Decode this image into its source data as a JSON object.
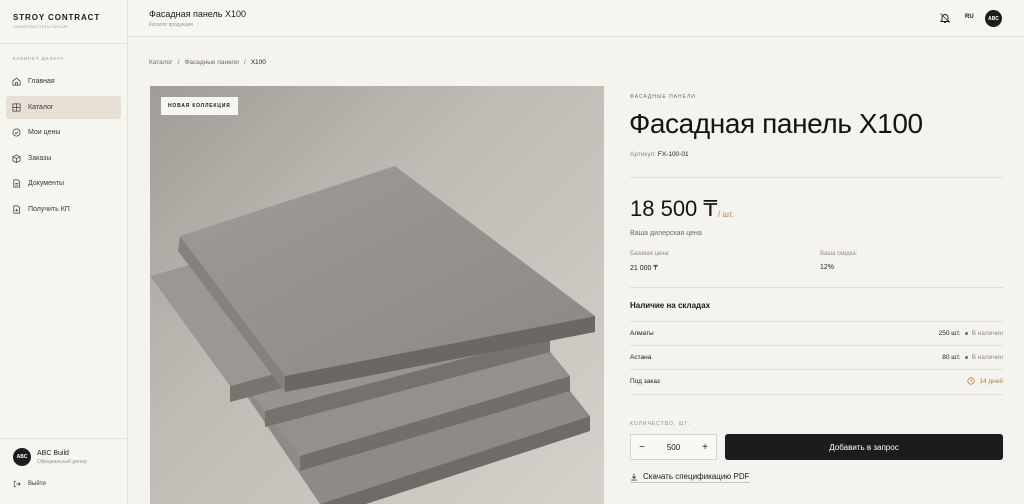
{
  "brand": {
    "name": "STROY CONTRACT",
    "subtitle": "CONSTRUCTION GROUP"
  },
  "sidebar": {
    "section_label": "КАБИНЕТ ДИЛЕРА",
    "items": [
      {
        "label": "Главная",
        "icon": "home-icon",
        "active": false
      },
      {
        "label": "Каталог",
        "icon": "grid-icon",
        "active": true
      },
      {
        "label": "Мои цены",
        "icon": "check-circle-icon",
        "active": false
      },
      {
        "label": "Заказы",
        "icon": "box-icon",
        "active": false
      },
      {
        "label": "Документы",
        "icon": "document-icon",
        "active": false
      },
      {
        "label": "Получить КП",
        "icon": "file-plus-icon",
        "active": false
      }
    ],
    "user": {
      "initials": "ABC",
      "name": "ABC Build",
      "role": "Официальный дилер"
    },
    "logout_label": "Выйти"
  },
  "topbar": {
    "title": "Фасадная панель X100",
    "subtitle": "Каталог продукции",
    "language": "RU",
    "avatar_initials": "ABC"
  },
  "breadcrumb": [
    "Каталог",
    "Фасадные панели",
    "X100"
  ],
  "product": {
    "badge": "НОВАЯ КОЛЛЕКЦИЯ",
    "category": "ФАСАДНЫЕ ПАНЕЛИ",
    "title": "Фасадная панель X100",
    "sku_label": "Артикул:",
    "sku": "FX-100-01",
    "price": "18 500 ₸",
    "price_unit": "/ шт.",
    "price_caption": "Ваша дилерская цена",
    "base_price_label": "Базовая цена:",
    "base_price": "21 000 ₸",
    "discount_label": "Ваша скидка:",
    "discount": "12%"
  },
  "stock": {
    "title": "Наличие на складах",
    "rows": [
      {
        "location": "Алматы",
        "qty": "250 шт.",
        "status": "В наличии"
      },
      {
        "location": "Астана",
        "qty": "80 шт.",
        "status": "В наличии"
      },
      {
        "location": "Под заказ",
        "qty": "",
        "status": "14 дней"
      }
    ]
  },
  "order": {
    "qty_label": "КОЛИЧЕСТВО, ШТ.",
    "qty_value": "500",
    "minus": "−",
    "plus": "+",
    "add_button": "Добавить в запрос",
    "download_label": "Скачать спецификацию PDF"
  },
  "colors": {
    "accent": "#b5803c",
    "dark": "#1b1c1e",
    "active_nav": "#e8e0d7",
    "background": "#f5f3ee"
  }
}
